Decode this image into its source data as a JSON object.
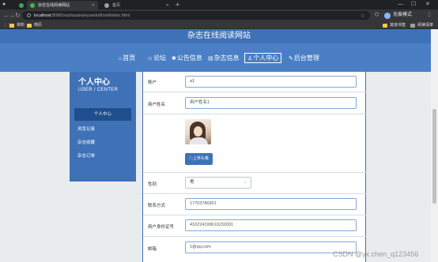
{
  "browser": {
    "tabs": [
      {
        "label": "杂志在线阅读网站",
        "active": true
      },
      {
        "label": "首页",
        "active": false
      }
    ],
    "new_tab": "+",
    "url_host": "localhost",
    "url_path": ":8080/zazhizaixianyuedu/front/index.html",
    "profile_label": "无痕模式",
    "bookmarks": [
      "资料",
      "简历"
    ],
    "bookmarks_right": [
      "其他书签",
      "阅读清单"
    ]
  },
  "site": {
    "title": "杂志在线阅读网站",
    "nav": [
      {
        "icon": "⌂",
        "label": "首页",
        "active": false
      },
      {
        "icon": "☺",
        "label": "论坛",
        "active": false
      },
      {
        "icon": "✱",
        "label": "公告信息",
        "active": false
      },
      {
        "icon": "▤",
        "label": "杂志信息",
        "active": false
      },
      {
        "icon": "♙",
        "label": "个人中心",
        "active": true
      },
      {
        "icon": "✎",
        "label": "后台管理",
        "active": false
      }
    ]
  },
  "sidebar": {
    "title": "个人中心",
    "subtitle": "USER / CENTER",
    "items": [
      "个人中心",
      "浏览记录",
      "杂志收藏",
      "杂志订单"
    ]
  },
  "form": {
    "rows": [
      {
        "label": "账户",
        "value": "a1",
        "type": "input"
      },
      {
        "label": "用户姓名",
        "value": "用户姓名1",
        "type": "input"
      },
      {
        "label": "",
        "value": "",
        "type": "avatar"
      },
      {
        "label": "性别",
        "value": "男",
        "type": "select"
      },
      {
        "label": "联系方式",
        "value": "17703786901",
        "type": "input"
      },
      {
        "label": "用户身份证号",
        "value": "410224199610232001",
        "type": "input"
      },
      {
        "label": "邮箱",
        "value": "1@qq.com",
        "type": "input"
      }
    ],
    "upload_label": "上传头像"
  },
  "watermark": "CSDN @yx.chen_q123456",
  "colors": {
    "brand": "#3f71b6",
    "nav": "#4a7fc6",
    "active_item": "#1f4e8c"
  }
}
